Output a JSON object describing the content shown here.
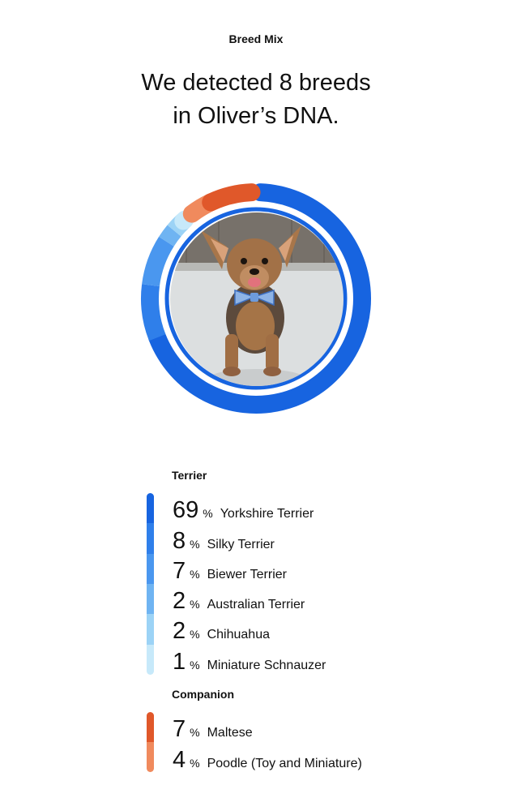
{
  "header": {
    "section_label": "Breed Mix",
    "headline_line1": "We detected 8 breeds",
    "headline_line2": "in Oliver’s DNA."
  },
  "photo": {
    "alt": "Oliver the dog wearing a blue checkered bow tie"
  },
  "chart_data": {
    "type": "pie",
    "title": "",
    "groups": [
      {
        "name": "Terrier",
        "items": [
          {
            "label": "Yorkshire Terrier",
            "value": 69,
            "color": "#1764e0"
          },
          {
            "label": "Silky Terrier",
            "value": 8,
            "color": "#2f7fea"
          },
          {
            "label": "Biewer Terrier",
            "value": 7,
            "color": "#4a97ef"
          },
          {
            "label": "Australian Terrier",
            "value": 2,
            "color": "#6fb4f2"
          },
          {
            "label": "Chihuahua",
            "value": 2,
            "color": "#9cd3f6"
          },
          {
            "label": "Miniature Schnauzer",
            "value": 1,
            "color": "#c7e9fa"
          }
        ]
      },
      {
        "name": "Companion",
        "items": [
          {
            "label": "Maltese",
            "value": 7,
            "color": "#e0582a"
          },
          {
            "label": "Poodle (Toy and Miniature)",
            "value": 4,
            "color": "#f08a5d"
          }
        ]
      }
    ],
    "percent_symbol": "%"
  }
}
